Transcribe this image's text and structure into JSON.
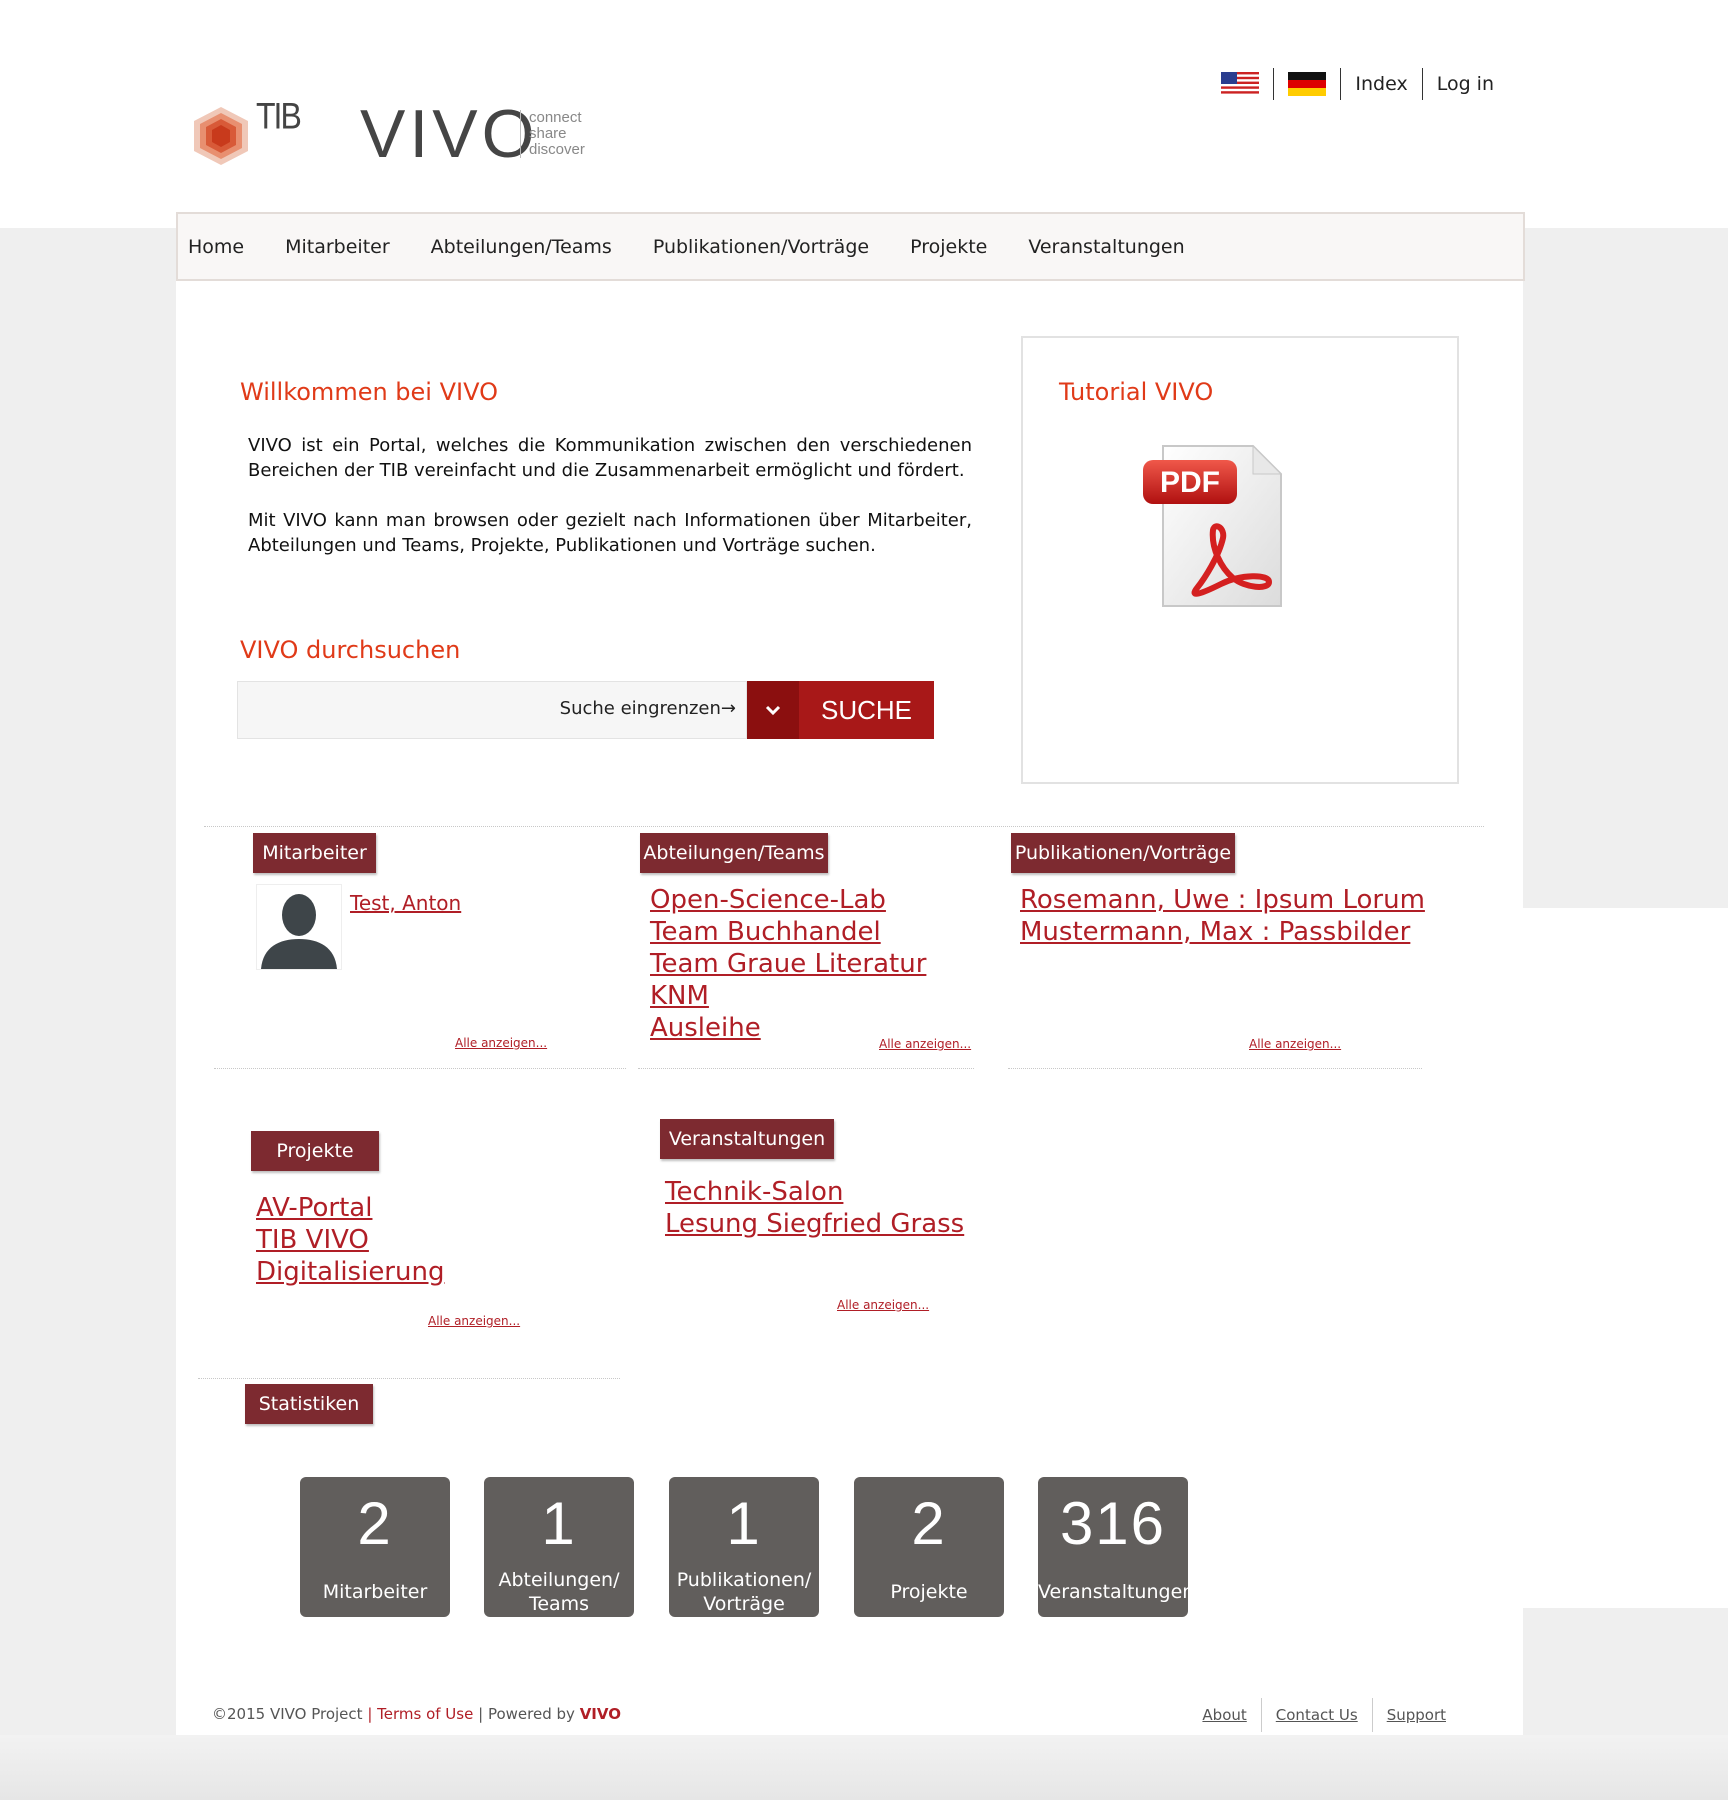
{
  "header": {
    "tib_logo_text": "TIB",
    "vivo_logo_text": "VIVO",
    "vivo_tagline": [
      "connect",
      "share",
      "discover"
    ],
    "top_links": {
      "index": "Index",
      "login": "Log in"
    }
  },
  "nav": [
    "Home",
    "Mitarbeiter",
    "Abteilungen/Teams",
    "Publikationen/Vorträge",
    "Projekte",
    "Veranstaltungen"
  ],
  "welcome": {
    "title": "Willkommen bei VIVO",
    "para1": "VIVO ist ein Portal, welches die Kommunikation zwischen den verschiedenen Bereichen der TIB vereinfacht und die Zusammenarbeit ermöglicht und fördert.",
    "para2": "Mit VIVO kann man browsen oder gezielt nach Informationen über Mitarbeiter, Abteilungen und Teams, Projekte, Publikationen und Vorträge suchen."
  },
  "search": {
    "title": "VIVO durchsuchen",
    "refine_label": "Suche eingrenzen→",
    "button": "SUCHE"
  },
  "tutorial": {
    "title": "Tutorial VIVO",
    "icon_label": "PDF"
  },
  "sections": {
    "mitarbeiter": {
      "label": "Mitarbeiter",
      "person": "Test, Anton",
      "all": "Alle anzeigen..."
    },
    "abteilungen": {
      "label": "Abteilungen/Teams",
      "items": [
        "Open-Science-Lab",
        "Team Buchhandel",
        "Team Graue Literatur",
        "KNM",
        "Ausleihe"
      ],
      "all": "Alle anzeigen..."
    },
    "publikationen": {
      "label": "Publikationen/Vorträge",
      "items": [
        "Rosemann, Uwe : Ipsum Lorum",
        "Mustermann, Max : Passbilder"
      ],
      "all": "Alle anzeigen..."
    },
    "projekte": {
      "label": "Projekte",
      "items": [
        "AV-Portal",
        "TIB VIVO",
        "Digitalisierung"
      ],
      "all": "Alle anzeigen..."
    },
    "veranstaltungen": {
      "label": "Veranstaltungen",
      "items": [
        "Technik-Salon",
        "Lesung Siegfried Grass"
      ],
      "all": "Alle anzeigen..."
    },
    "statistiken": {
      "label": "Statistiken"
    }
  },
  "stats": [
    {
      "num": "2",
      "label1": "Mitarbeiter",
      "label2": ""
    },
    {
      "num": "1",
      "label1": "Abteilungen/",
      "label2": "Teams"
    },
    {
      "num": "1",
      "label1": "Publikationen/",
      "label2": "Vorträge"
    },
    {
      "num": "2",
      "label1": "Projekte",
      "label2": ""
    },
    {
      "num": "316",
      "label1": "Veranstaltungen",
      "label2": ""
    }
  ],
  "footer": {
    "copyright": "©2015 VIVO Project",
    "terms": "Terms of Use",
    "powered": "Powered by",
    "powered_brand": "VIVO",
    "links": [
      "About",
      "Contact Us",
      "Support"
    ]
  },
  "colors": {
    "accent_red": "#e03a18",
    "link_red": "#b01e26",
    "tag_bg": "#7d2a30",
    "button_red": "#a81818",
    "stat_bg": "#615e5c"
  }
}
